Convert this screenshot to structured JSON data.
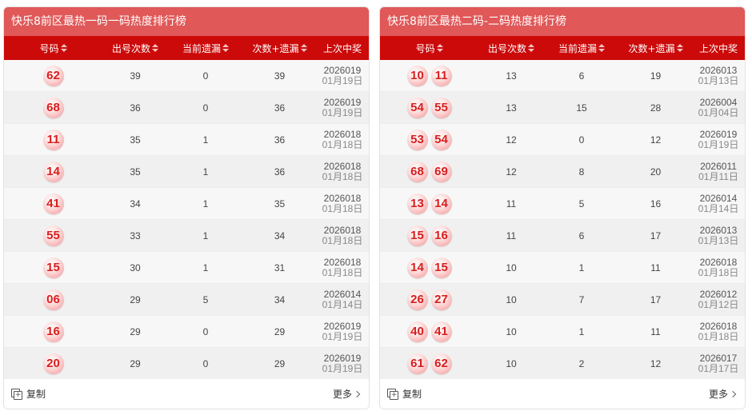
{
  "panels": [
    {
      "title": "快乐8前区最热一码一码热度排行榜",
      "headers": [
        "号码",
        "出号次数",
        "当前遗漏",
        "次数+遗漏",
        "上次中奖"
      ],
      "rows": [
        {
          "balls": [
            "62"
          ],
          "count": "39",
          "miss": "0",
          "sum": "39",
          "issue": "2026019",
          "date": "01月19日"
        },
        {
          "balls": [
            "68"
          ],
          "count": "36",
          "miss": "0",
          "sum": "36",
          "issue": "2026019",
          "date": "01月19日"
        },
        {
          "balls": [
            "11"
          ],
          "count": "35",
          "miss": "1",
          "sum": "36",
          "issue": "2026018",
          "date": "01月18日"
        },
        {
          "balls": [
            "14"
          ],
          "count": "35",
          "miss": "1",
          "sum": "36",
          "issue": "2026018",
          "date": "01月18日"
        },
        {
          "balls": [
            "41"
          ],
          "count": "34",
          "miss": "1",
          "sum": "35",
          "issue": "2026018",
          "date": "01月18日"
        },
        {
          "balls": [
            "55"
          ],
          "count": "33",
          "miss": "1",
          "sum": "34",
          "issue": "2026018",
          "date": "01月18日"
        },
        {
          "balls": [
            "15"
          ],
          "count": "30",
          "miss": "1",
          "sum": "31",
          "issue": "2026018",
          "date": "01月18日"
        },
        {
          "balls": [
            "06"
          ],
          "count": "29",
          "miss": "5",
          "sum": "34",
          "issue": "2026014",
          "date": "01月14日"
        },
        {
          "balls": [
            "16"
          ],
          "count": "29",
          "miss": "0",
          "sum": "29",
          "issue": "2026019",
          "date": "01月19日"
        },
        {
          "balls": [
            "20"
          ],
          "count": "29",
          "miss": "0",
          "sum": "29",
          "issue": "2026019",
          "date": "01月19日"
        }
      ],
      "copy_label": "复制",
      "more_label": "更多"
    },
    {
      "title": "快乐8前区最热二码-二码热度排行榜",
      "headers": [
        "号码",
        "出号次数",
        "当前遗漏",
        "次数+遗漏",
        "上次中奖"
      ],
      "rows": [
        {
          "balls": [
            "10",
            "11"
          ],
          "count": "13",
          "miss": "6",
          "sum": "19",
          "issue": "2026013",
          "date": "01月13日"
        },
        {
          "balls": [
            "54",
            "55"
          ],
          "count": "13",
          "miss": "15",
          "sum": "28",
          "issue": "2026004",
          "date": "01月04日"
        },
        {
          "balls": [
            "53",
            "54"
          ],
          "count": "12",
          "miss": "0",
          "sum": "12",
          "issue": "2026019",
          "date": "01月19日"
        },
        {
          "balls": [
            "68",
            "69"
          ],
          "count": "12",
          "miss": "8",
          "sum": "20",
          "issue": "2026011",
          "date": "01月11日"
        },
        {
          "balls": [
            "13",
            "14"
          ],
          "count": "11",
          "miss": "5",
          "sum": "16",
          "issue": "2026014",
          "date": "01月14日"
        },
        {
          "balls": [
            "15",
            "16"
          ],
          "count": "11",
          "miss": "6",
          "sum": "17",
          "issue": "2026013",
          "date": "01月13日"
        },
        {
          "balls": [
            "14",
            "15"
          ],
          "count": "10",
          "miss": "1",
          "sum": "11",
          "issue": "2026018",
          "date": "01月18日"
        },
        {
          "balls": [
            "26",
            "27"
          ],
          "count": "10",
          "miss": "7",
          "sum": "17",
          "issue": "2026012",
          "date": "01月12日"
        },
        {
          "balls": [
            "40",
            "41"
          ],
          "count": "10",
          "miss": "1",
          "sum": "11",
          "issue": "2026018",
          "date": "01月18日"
        },
        {
          "balls": [
            "61",
            "62"
          ],
          "count": "10",
          "miss": "2",
          "sum": "12",
          "issue": "2026017",
          "date": "01月17日"
        }
      ],
      "copy_label": "复制",
      "more_label": "更多"
    }
  ],
  "colors": {
    "title_bar": "#e05858",
    "header_bar": "#cc0a0a",
    "ball_text": "#d81e1e"
  },
  "icons": {
    "copy": "copy-icon",
    "more": "chevron-right-icon",
    "sort": "sort-icon"
  }
}
